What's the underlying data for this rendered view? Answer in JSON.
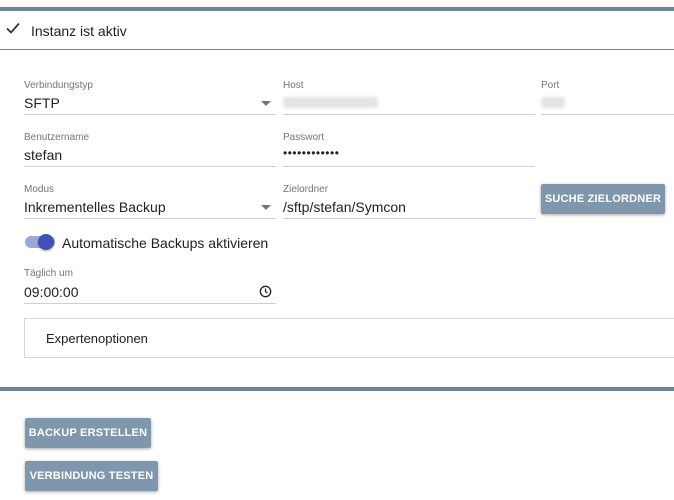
{
  "status": {
    "text": "Instanz ist aktiv",
    "icon": "check-icon"
  },
  "form": {
    "connection_type": {
      "label": "Verbindungstyp",
      "value": "SFTP"
    },
    "host": {
      "label": "Host",
      "value": ""
    },
    "port": {
      "label": "Port",
      "value": ""
    },
    "username": {
      "label": "Benutzername",
      "value": "stefan"
    },
    "password": {
      "label": "Passwort",
      "value": "••••••••••••"
    },
    "mode": {
      "label": "Modus",
      "value": "Inkrementelles Backup"
    },
    "target_folder": {
      "label": "Zielordner",
      "value": "/sftp/stefan/Symcon"
    },
    "search_folder_button": "SUCHE ZIELORDNER",
    "auto_backup": {
      "label": "Automatische Backups aktivieren",
      "enabled": true
    },
    "daily_at": {
      "label": "Täglich um",
      "value": "09:00:00"
    },
    "expert_options": "Expertenoptionen"
  },
  "actions": {
    "create_backup": "BACKUP ERSTELLEN",
    "test_connection": "VERBINDUNG TESTEN"
  },
  "colors": {
    "accent": "#3f51b5",
    "button": "#7e97ad",
    "bar": "#6e8599"
  }
}
